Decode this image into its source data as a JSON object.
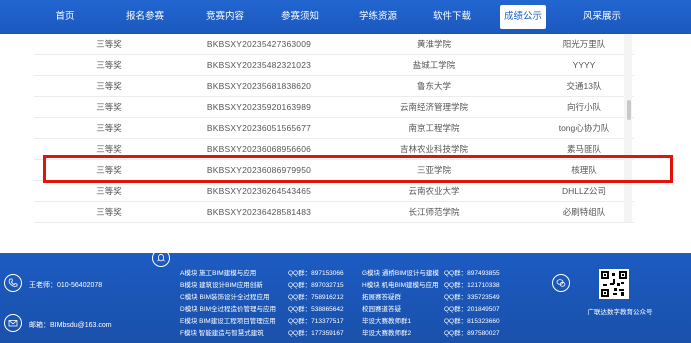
{
  "nav": {
    "items": [
      {
        "label": "首页",
        "active": false
      },
      {
        "label": "报名参赛",
        "active": false
      },
      {
        "label": "竞赛内容",
        "active": false
      },
      {
        "label": "参赛须知",
        "active": false
      },
      {
        "label": "学练资源",
        "active": false
      },
      {
        "label": "软件下载",
        "active": false
      },
      {
        "label": "成绩公示",
        "active": true
      },
      {
        "label": "风采展示",
        "active": false
      }
    ]
  },
  "table": {
    "rows": [
      {
        "award": "三等奖",
        "code": "BKBSXY20235427363009",
        "school": "黄淮学院",
        "team": "阳光万里队"
      },
      {
        "award": "三等奖",
        "code": "BKBSXY20235482321023",
        "school": "盐城工学院",
        "team": "YYYY"
      },
      {
        "award": "三等奖",
        "code": "BKBSXY20235681838620",
        "school": "鲁东大学",
        "team": "交通13队"
      },
      {
        "award": "三等奖",
        "code": "BKBSXY20235920163989",
        "school": "云南经济管理学院",
        "team": "向行小队"
      },
      {
        "award": "三等奖",
        "code": "BKBSXY20236051565677",
        "school": "南京工程学院",
        "team": "tong心协力队"
      },
      {
        "award": "三等奖",
        "code": "BKBSXY20236068956606",
        "school": "吉林农业科技学院",
        "team": "素马匪队"
      },
      {
        "award": "三等奖",
        "code": "BKBSXY20236086979950",
        "school": "三亚学院",
        "team": "核理队"
      },
      {
        "award": "三等奖",
        "code": "BKBSXY20236264543465",
        "school": "云南农业大学",
        "team": "DHLLZ公司"
      },
      {
        "award": "三等奖",
        "code": "BKBSXY20236428581483",
        "school": "长江师范学院",
        "team": "必刷特组队"
      }
    ]
  },
  "footer": {
    "phone": "王老师：010-56402078",
    "email": "邮箱：BIMbsdu@163.com",
    "groups_col1": [
      "A模块 施工BIM建模与应用",
      "B模块 建筑设计BIM应用创新",
      "C模块 BIM装饰设计全过程应用",
      "D模块 BIM全过程造价管理与应用",
      "E模块 BIM建设工程项目管理应用",
      "F模块 智能建造与智慧式建筑"
    ],
    "qq_col1": [
      "QQ群：897153066",
      "QQ群：897032715",
      "QQ群：758916212",
      "QQ群：538865642",
      "QQ群：713377517",
      "QQ群：177359167"
    ],
    "groups_col2": [
      "G模块 通桥BIM设计与建模",
      "H模块 机电BIM建模与应用",
      "拓展赛答疑群",
      "校园赛道答疑",
      "毕设大赛教师群1",
      "毕设大赛教师群2"
    ],
    "qq_col2": [
      "QQ群：897493855",
      "QQ群：121710338",
      "QQ群：335723549",
      "QQ群：201849507",
      "QQ群：815323660",
      "QQ群：897580027"
    ],
    "qr_label": "广联达数字教育公众号",
    "icons": [
      "phone-icon",
      "mail-icon",
      "qq-icon",
      "wechat-icon"
    ]
  },
  "colors": {
    "brand_blue": "#1e5fc8",
    "highlight_red": "#e3120b"
  }
}
